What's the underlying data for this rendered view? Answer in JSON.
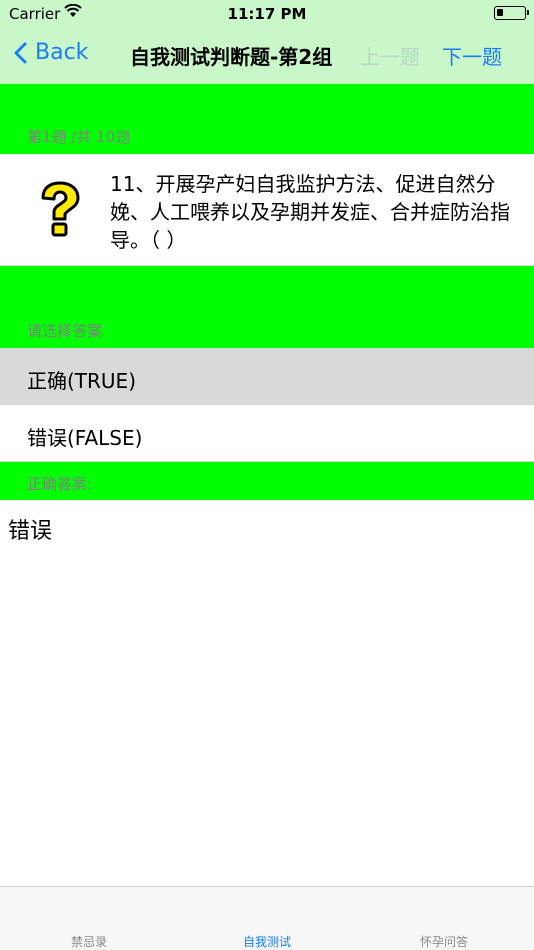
{
  "status_bar": {
    "carrier": "Carrier",
    "time": "11:17 PM"
  },
  "nav": {
    "back_label": "Back",
    "title": "自我测试判断题-第2组",
    "prev_label": "上一题",
    "next_label": "下一题",
    "accent_color": "#1a7df5",
    "disabled_color": "#b9d7c4"
  },
  "question": {
    "progress": "第1题 /共 10题",
    "text": "11、开展孕产妇自我监护方法、促进自然分娩、人工喂养以及孕期并发症、合并症防治指导。（ ）",
    "icon": "question-mark-icon"
  },
  "answers": {
    "prompt": "请选择答案",
    "options": [
      "正确(TRUE)",
      "错误(FALSE)"
    ],
    "selected_index": 0
  },
  "correct": {
    "label": "正确答案:",
    "value": "错误"
  },
  "tab_bar": {
    "tabs": [
      {
        "label": "禁忌录"
      },
      {
        "label": "自我测试"
      },
      {
        "label": "怀孕问答"
      }
    ],
    "active_index": 1
  },
  "colors": {
    "header_bg": "#c9f7c9",
    "section_bg": "#00ff00",
    "selected_bg": "#d9d9d9"
  }
}
